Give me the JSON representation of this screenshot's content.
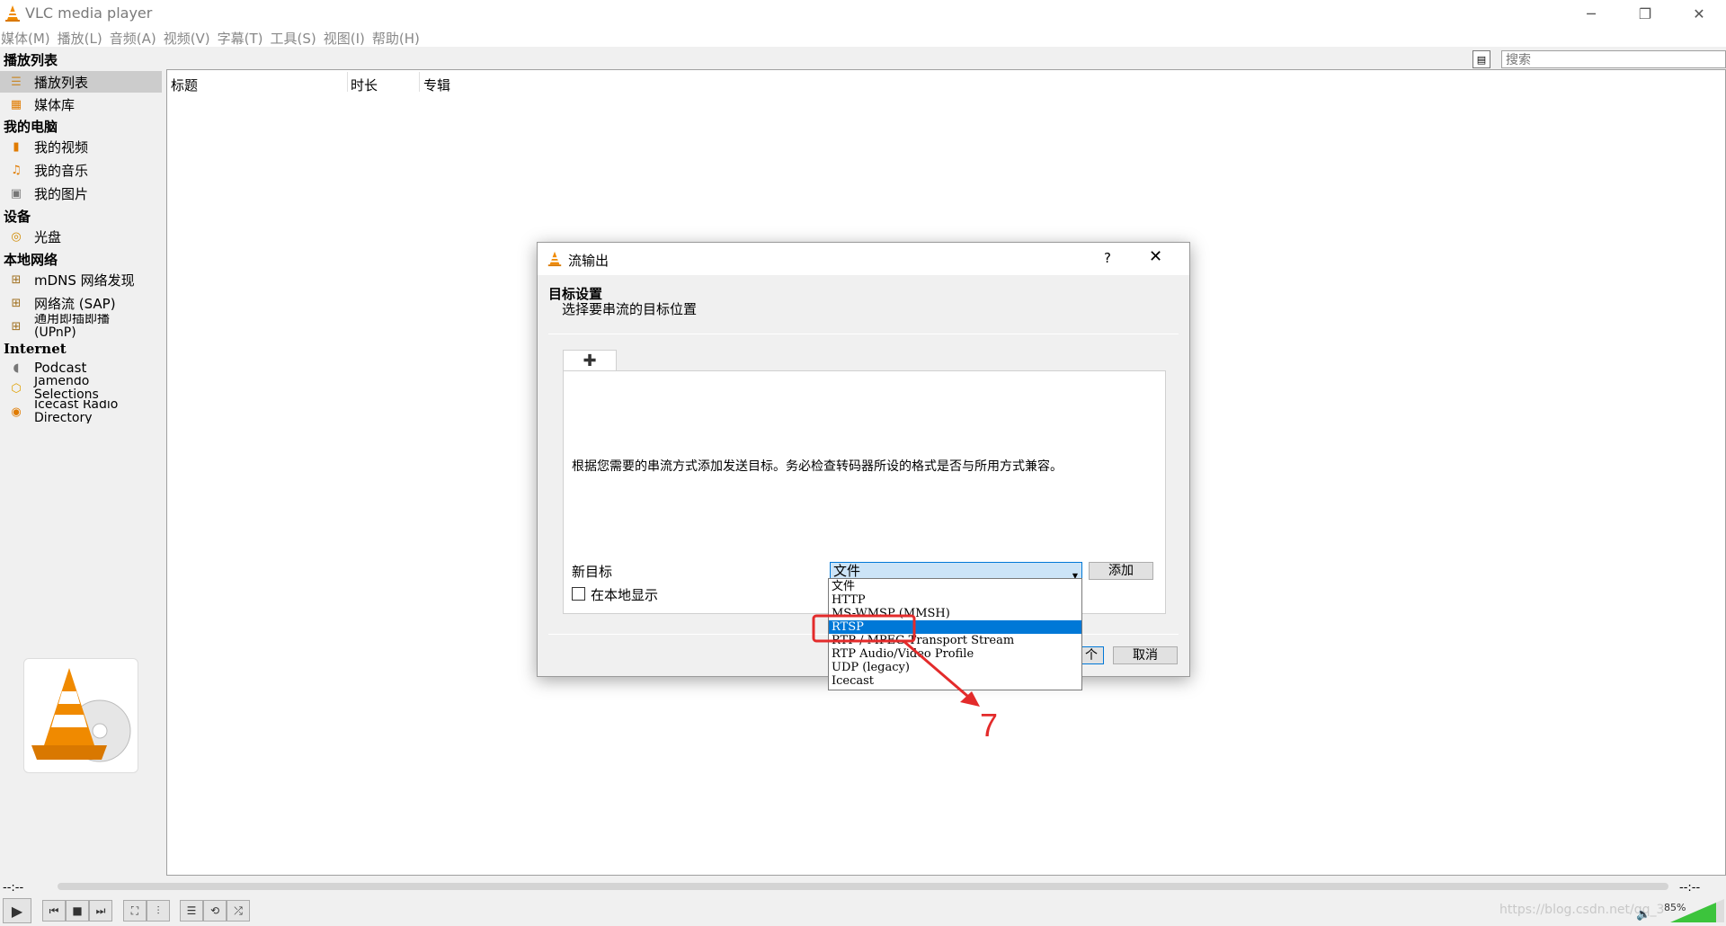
{
  "window": {
    "title": "VLC media player",
    "minimize": "─",
    "restore": "❐",
    "close": "✕"
  },
  "menu": [
    "媒体(M)",
    "播放(L)",
    "音频(A)",
    "视频(V)",
    "字幕(T)",
    "工具(S)",
    "视图(I)",
    "帮助(H)"
  ],
  "playlist": {
    "header": "播放列表",
    "search_placeholder": "搜索",
    "columns": [
      "标题",
      "时长",
      "专辑"
    ]
  },
  "sidebar": {
    "sections": [
      "我的电脑",
      "设备",
      "本地网络",
      "Internet"
    ],
    "items": [
      {
        "label": "播放列表",
        "icon": "playlist-icon",
        "selected": true
      },
      {
        "label": "媒体库",
        "icon": "media-library-icon"
      },
      {
        "label": "我的视频",
        "icon": "video-icon"
      },
      {
        "label": "我的音乐",
        "icon": "music-icon"
      },
      {
        "label": "我的图片",
        "icon": "picture-icon"
      },
      {
        "label": "光盘",
        "icon": "disc-icon"
      },
      {
        "label": "mDNS 网络发现",
        "icon": "network-icon"
      },
      {
        "label": "网络流 (SAP)",
        "icon": "network-icon"
      },
      {
        "label": "通用即插即播 (UPnP)",
        "icon": "network-icon"
      },
      {
        "label": "Podcast",
        "icon": "podcast-icon"
      },
      {
        "label": "Jamendo Selections",
        "icon": "jamendo-icon"
      },
      {
        "label": "Icecast Radio Directory",
        "icon": "radio-icon"
      }
    ]
  },
  "controls": {
    "time_elapsed": "--:--",
    "time_total": "--:--",
    "volume": "85%"
  },
  "watermark": "https://blog.csdn.net/qq_3",
  "dialog": {
    "title": "流输出",
    "help": "?",
    "close": "✕",
    "heading": "目标设置",
    "subheading": "选择要串流的目标位置",
    "tab_label": "✚",
    "hint": "根据您需要的串流方式添加发送目标。务必检查转码器所设的格式是否与所用方式兼容。",
    "new_destination_label": "新目标",
    "selected_destination": "文件",
    "add_button": "添加",
    "show_locally": "在本地显示",
    "next_button": "个",
    "cancel_button": "取消",
    "dropdown_options": [
      "文件",
      "HTTP",
      "MS-WMSP (MMSH)",
      "RTSP",
      "RTP / MPEG Transport Stream",
      "RTP Audio/Video Profile",
      "UDP (legacy)",
      "Icecast"
    ],
    "highlighted_option": "RTSP"
  },
  "annotation": {
    "step_number": "7",
    "color": "#e32b2b"
  }
}
